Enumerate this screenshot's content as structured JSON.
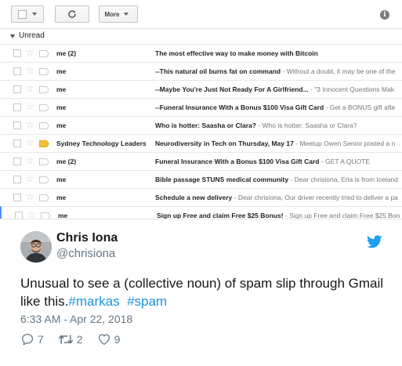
{
  "toolbar": {
    "more_label": "More",
    "icons": [
      "select-checkbox-icon",
      "chevron-down-icon",
      "refresh-icon",
      "info-icon"
    ]
  },
  "section": {
    "label": "Unread"
  },
  "emails": [
    {
      "sender": "me (2)",
      "subject": "The most effective way to make money with Bitcoin",
      "snippet": "",
      "important": false
    },
    {
      "sender": "me",
      "subject": "--This natural oil burns fat on command",
      "snippet": " - Without a doubt, it may be one of the",
      "important": false
    },
    {
      "sender": "me",
      "subject": "--Maybe You're Just Not Ready For A Girlfriend...",
      "snippet": " - \"3 Innocent Questions Mak",
      "important": false
    },
    {
      "sender": "me",
      "subject": "--Funeral Insurance With a Bonus $100 Visa Gift Card",
      "snippet": " - Get a BONUS gift afte",
      "important": false
    },
    {
      "sender": "me",
      "subject": "Who is hotter: Saasha or Clara?",
      "snippet": " - Who is hotter: Saasha or Clara?",
      "important": false
    },
    {
      "sender": "Sydney Technology Leaders",
      "subject": "Neurodiversity in Tech on Thursday, May 17",
      "snippet": " - Meetup Owen Senior posted a n",
      "important": true
    },
    {
      "sender": "me (2)",
      "subject": "Funeral Insurance With a Bonus $100 Visa Gift Card",
      "snippet": " - GET A QUOTE",
      "important": false
    },
    {
      "sender": "me",
      "subject": "Bible passage STUNS medical community",
      "snippet": " - Dear chrisiona, Erla is from Iceland",
      "important": false
    },
    {
      "sender": "me",
      "subject": "Schedule a new delivery",
      "snippet": " - Dear chrisiona, Our driver recently tried to deliver a pa",
      "important": false
    },
    {
      "sender": "me",
      "subject": "Sign up Free and claim Free $25 Bonus!",
      "snippet": " - Sign up Free and claim Free $25 Bon",
      "important": false
    }
  ],
  "tweet": {
    "name": "Chris Iona",
    "handle": "@chrisiona",
    "text_before": "Unusual to see a (collective noun) of spam slip through Gmail like this.",
    "hashtag1": "#markas",
    "text_between": "  ",
    "hashtag2": "#spam",
    "timestamp": "6:33 AM - Apr 22, 2018",
    "replies": "7",
    "retweets": "2",
    "likes": "9",
    "colors": {
      "link": "#1b95e0",
      "twitter_blue": "#1da1f2",
      "muted": "#657786"
    },
    "icons": [
      "avatar",
      "twitter-bird-icon",
      "reply-icon",
      "retweet-icon",
      "heart-icon"
    ]
  }
}
